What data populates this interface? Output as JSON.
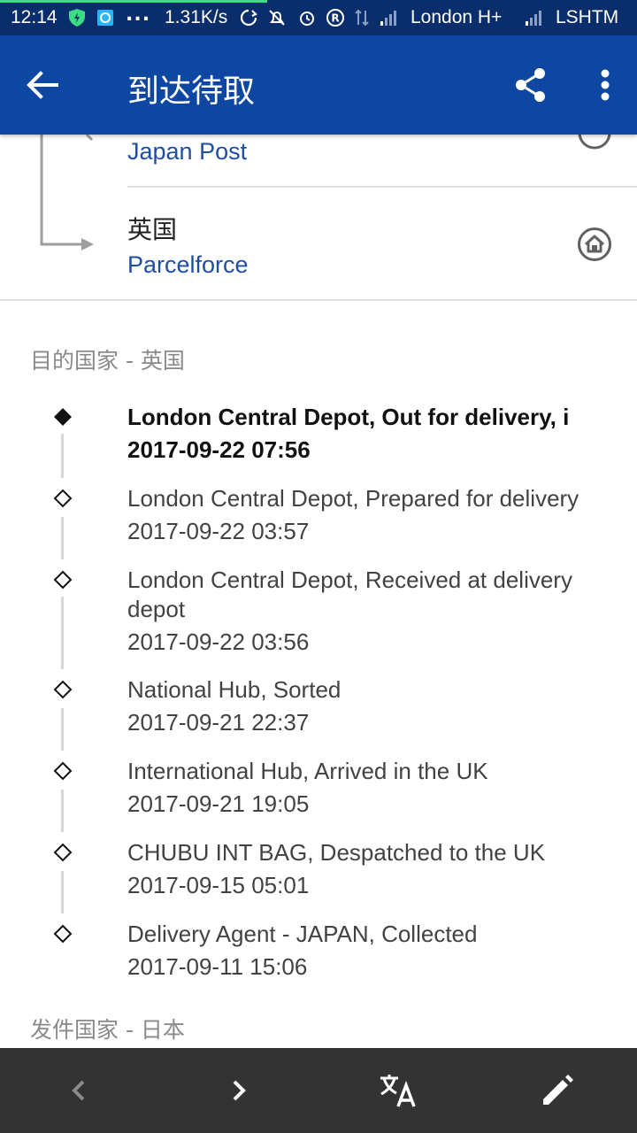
{
  "status_bar": {
    "time": "12:14",
    "network_speed": "1.31K/s",
    "overflow": "...",
    "carrier_1": "London H+",
    "carrier_2": "LSHTM"
  },
  "app_bar": {
    "title": "到达待取"
  },
  "carriers": {
    "origin_carrier": "Japan Post",
    "destination_country": "英国",
    "destination_carrier": "Parcelforce"
  },
  "destination_section": {
    "header": "目的国家 - 英国",
    "events": [
      {
        "description": "London Central Depot, Out for delivery, i",
        "time": "2017-09-22 07:56"
      },
      {
        "description": "London Central Depot, Prepared for delivery",
        "time": "2017-09-22 03:57"
      },
      {
        "description": "London Central Depot, Received at delivery depot",
        "time": "2017-09-22 03:56"
      },
      {
        "description": "National Hub, Sorted",
        "time": "2017-09-21 22:37"
      },
      {
        "description": "International Hub, Arrived in the UK",
        "time": "2017-09-21 19:05"
      },
      {
        "description": "CHUBU INT BAG, Despatched to the UK",
        "time": "2017-09-15 05:01"
      },
      {
        "description": "Delivery Agent - JAPAN, Collected",
        "time": "2017-09-11 15:06"
      }
    ]
  },
  "origin_section": {
    "header": "发件国家 - 日本"
  },
  "icons": {
    "back": "arrow-back-icon",
    "share": "share-icon",
    "more": "more-vert-icon",
    "home": "home-icon",
    "prev": "chevron-left-icon",
    "next": "chevron-right-icon",
    "translate": "translate-icon",
    "edit": "edit-icon"
  },
  "colors": {
    "status_bar": "#0a2d6b",
    "app_bar": "#0d47a1",
    "carrier_link": "#1e4fa3",
    "bottom_bar": "#333333"
  }
}
